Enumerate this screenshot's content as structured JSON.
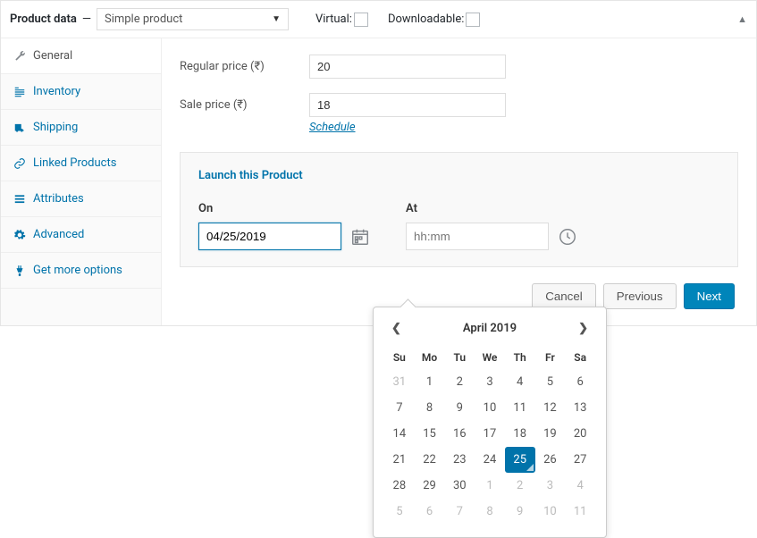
{
  "header": {
    "title": "Product data",
    "product_type": "Simple product",
    "virtual_label": "Virtual:",
    "downloadable_label": "Downloadable:"
  },
  "sidebar": {
    "items": [
      {
        "label": "General",
        "icon": "wrench-icon"
      },
      {
        "label": "Inventory",
        "icon": "inventory-icon"
      },
      {
        "label": "Shipping",
        "icon": "truck-icon"
      },
      {
        "label": "Linked Products",
        "icon": "link-icon"
      },
      {
        "label": "Attributes",
        "icon": "list-icon"
      },
      {
        "label": "Advanced",
        "icon": "gear-icon"
      },
      {
        "label": "Get more options",
        "icon": "plugin-icon"
      }
    ]
  },
  "pricing": {
    "regular_label": "Regular price (₹)",
    "regular_value": "20",
    "sale_label": "Sale price (₹)",
    "sale_value": "18",
    "schedule_link": "Schedule"
  },
  "launch": {
    "heading": "Launch this Product",
    "on_label": "On",
    "at_label": "At",
    "date_value": "04/25/2019",
    "time_placeholder": "hh:mm"
  },
  "buttons": {
    "cancel": "Cancel",
    "previous": "Previous",
    "next": "Next"
  },
  "datepicker": {
    "month_title": "April 2019",
    "dow": [
      "Su",
      "Mo",
      "Tu",
      "We",
      "Th",
      "Fr",
      "Sa"
    ],
    "weeks": [
      [
        {
          "d": "31",
          "o": true
        },
        {
          "d": "1"
        },
        {
          "d": "2"
        },
        {
          "d": "3"
        },
        {
          "d": "4"
        },
        {
          "d": "5"
        },
        {
          "d": "6"
        }
      ],
      [
        {
          "d": "7"
        },
        {
          "d": "8"
        },
        {
          "d": "9"
        },
        {
          "d": "10"
        },
        {
          "d": "11"
        },
        {
          "d": "12"
        },
        {
          "d": "13"
        }
      ],
      [
        {
          "d": "14"
        },
        {
          "d": "15"
        },
        {
          "d": "16"
        },
        {
          "d": "17"
        },
        {
          "d": "18"
        },
        {
          "d": "19"
        },
        {
          "d": "20"
        }
      ],
      [
        {
          "d": "21"
        },
        {
          "d": "22"
        },
        {
          "d": "23"
        },
        {
          "d": "24"
        },
        {
          "d": "25",
          "sel": true
        },
        {
          "d": "26"
        },
        {
          "d": "27"
        }
      ],
      [
        {
          "d": "28"
        },
        {
          "d": "29"
        },
        {
          "d": "30"
        },
        {
          "d": "1",
          "o": true
        },
        {
          "d": "2",
          "o": true
        },
        {
          "d": "3",
          "o": true
        },
        {
          "d": "4",
          "o": true
        }
      ],
      [
        {
          "d": "5",
          "o": true
        },
        {
          "d": "6",
          "o": true
        },
        {
          "d": "7",
          "o": true
        },
        {
          "d": "8",
          "o": true
        },
        {
          "d": "9",
          "o": true
        },
        {
          "d": "10",
          "o": true
        },
        {
          "d": "11",
          "o": true
        }
      ]
    ]
  }
}
